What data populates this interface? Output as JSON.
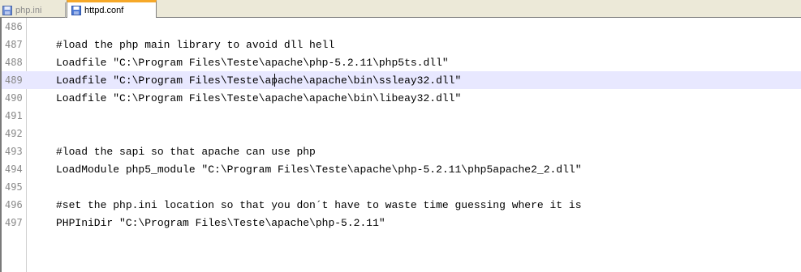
{
  "tabs": [
    {
      "label": "php.ini",
      "active": false,
      "icon": "save-file-icon"
    },
    {
      "label": "httpd.conf",
      "active": true,
      "icon": "save-file-icon"
    }
  ],
  "editor": {
    "lines": [
      {
        "number": "486",
        "text": ""
      },
      {
        "number": "487",
        "text": "#load the php main library to avoid dll hell"
      },
      {
        "number": "488",
        "text": "Loadfile \"C:\\Program Files\\Teste\\apache\\php-5.2.11\\php5ts.dll\""
      },
      {
        "number": "489",
        "text": "Loadfile \"C:\\Program Files\\Teste\\apache\\apache\\bin\\ssleay32.dll\""
      },
      {
        "number": "490",
        "text": "Loadfile \"C:\\Program Files\\Teste\\apache\\apache\\bin\\libeay32.dll\""
      },
      {
        "number": "491",
        "text": ""
      },
      {
        "number": "492",
        "text": ""
      },
      {
        "number": "493",
        "text": "#load the sapi so that apache can use php"
      },
      {
        "number": "494",
        "text": "LoadModule php5_module \"C:\\Program Files\\Teste\\apache\\php-5.2.11\\php5apache2_2.dll\""
      },
      {
        "number": "495",
        "text": ""
      },
      {
        "number": "496",
        "text": "#set the php.ini location so that you don´t have to waste time guessing where it is"
      },
      {
        "number": "497",
        "text": "PHPIniDir \"C:\\Program Files\\Teste\\apache\\php-5.2.11\""
      }
    ],
    "current_line": "489"
  },
  "colors": {
    "current_line_highlight": "#e8e8ff",
    "active_tab_accent": "#f6a828"
  }
}
